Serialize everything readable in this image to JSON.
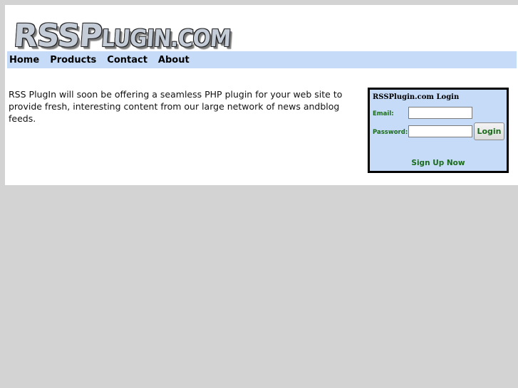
{
  "logo": {
    "big_text": "RSSP",
    "small_text": "LUGIN.COM"
  },
  "nav": {
    "items": [
      {
        "label": "Home"
      },
      {
        "label": "Products"
      },
      {
        "label": "Contact"
      },
      {
        "label": "About"
      }
    ]
  },
  "main": {
    "intro": "RSS PlugIn will soon be offering a seamless PHP plugin for your web site to provide fresh, interesting content from our large network of news andblog feeds."
  },
  "login": {
    "title": "RSSPlugin.com Login",
    "email_label": "Email:",
    "email_value": "",
    "password_label": "Password:",
    "password_value": "",
    "button_label": "Login",
    "signup_label": "Sign Up Now"
  },
  "colors": {
    "background": "#d3d3d3",
    "nav_bar": "#c5dbf7",
    "login_box": "#c5dbf7",
    "accent_green": "#1a6b1a"
  }
}
